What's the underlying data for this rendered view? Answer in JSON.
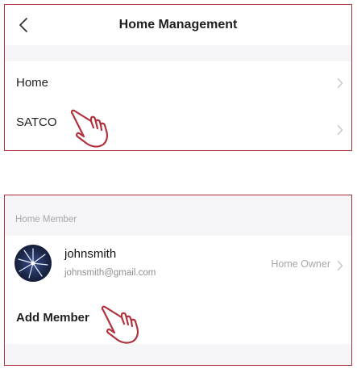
{
  "header": {
    "title": "Home Management"
  },
  "home_list": {
    "items": [
      {
        "label": "Home"
      },
      {
        "label": "SATCO"
      }
    ]
  },
  "members": {
    "section_title": "Home Member",
    "list": [
      {
        "name": "johnsmith",
        "email": "johnsmith@gmail.com",
        "role": "Home Owner",
        "avatar_icon": "starburst-avatar-icon"
      }
    ],
    "add_label": "Add Member"
  },
  "icons": {
    "back": "chevron-left-icon",
    "row_arrow": "chevron-right-icon",
    "pointer": "pointing-hand-icon"
  },
  "colors": {
    "highlight_border": "#b1323f",
    "hand_pointer": "#b1323f",
    "background": "#f5f5f7",
    "card": "#ffffff",
    "secondary_text": "#a8a8a8"
  }
}
